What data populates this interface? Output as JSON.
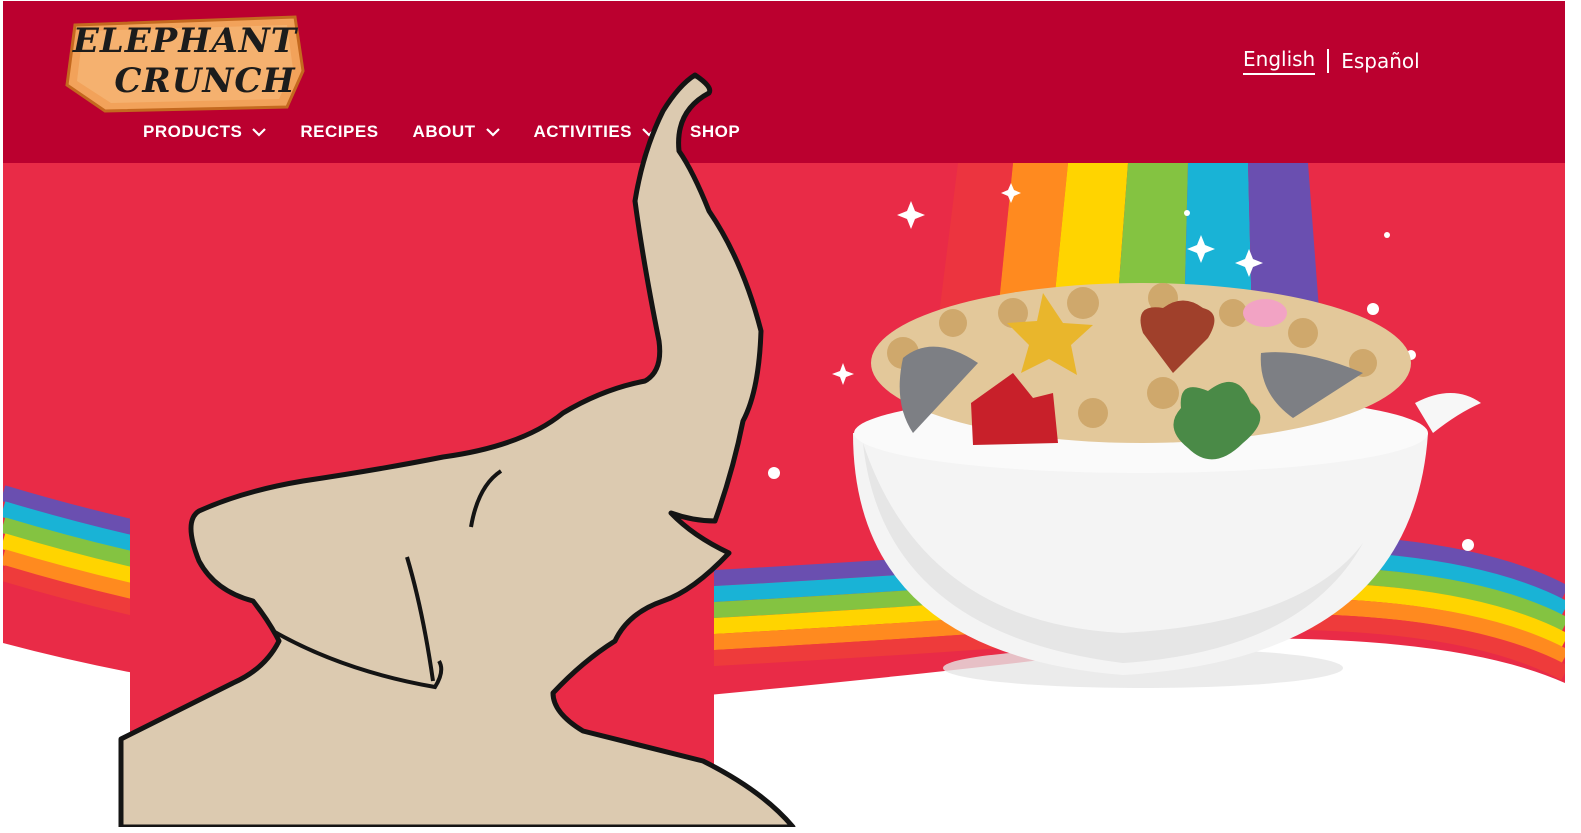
{
  "brand": {
    "logo_line1": "ELEPHANT",
    "logo_line2": "CRUNCH"
  },
  "nav": {
    "items": [
      {
        "label": "PRODUCTS",
        "has_dropdown": true
      },
      {
        "label": "RECIPES",
        "has_dropdown": false
      },
      {
        "label": "ABOUT",
        "has_dropdown": true
      },
      {
        "label": "ACTIVITIES",
        "has_dropdown": true
      },
      {
        "label": "SHOP",
        "has_dropdown": false
      }
    ]
  },
  "language": {
    "current": "English",
    "alternate": "Español"
  },
  "colors": {
    "header": "#bb002f",
    "hero": "#e92b47",
    "rainbow": [
      "#6a4fb0",
      "#19b3d6",
      "#84c341",
      "#ffd400",
      "#ff8a1f",
      "#ee3b3b"
    ]
  },
  "icons": {
    "dropdown": "chevron-down-icon"
  }
}
